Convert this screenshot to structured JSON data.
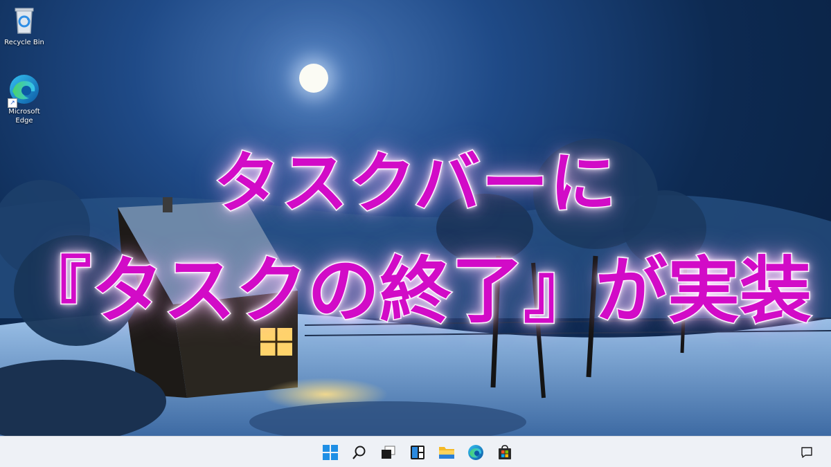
{
  "desktop": {
    "icons": [
      {
        "label": "Recycle Bin",
        "icon": "recycle-bin-icon"
      },
      {
        "label": "Microsoft\nEdge",
        "icon": "edge-icon"
      }
    ]
  },
  "headline": {
    "line1": "タスクバーに",
    "line2": "『タスクの終了』が実装",
    "color": "#d20bc7",
    "outline_color": "#ffffff"
  },
  "taskbar": {
    "background": "#eef1f6",
    "pinned": [
      {
        "name": "start",
        "icon": "windows-start-icon"
      },
      {
        "name": "search",
        "icon": "search-icon"
      },
      {
        "name": "task-view",
        "icon": "task-view-icon"
      },
      {
        "name": "widgets",
        "icon": "widgets-icon"
      },
      {
        "name": "file-explorer",
        "icon": "folder-icon"
      },
      {
        "name": "edge",
        "icon": "edge-icon"
      },
      {
        "name": "store",
        "icon": "store-icon"
      }
    ],
    "tray": [
      {
        "name": "notifications",
        "icon": "notification-icon"
      }
    ]
  }
}
